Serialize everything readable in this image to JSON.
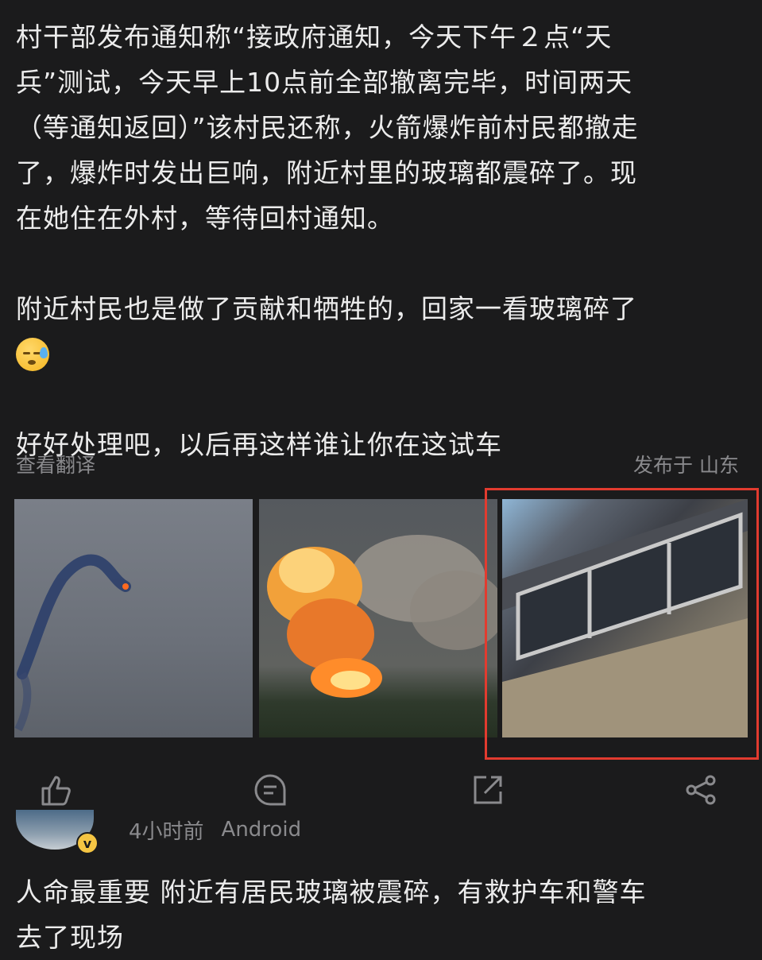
{
  "post": {
    "lines": [
      "村干部发布通知称“接政府通知，今天下午２点“天",
      "兵”测试，今天早上10点前全部撤离完毕，时间两天",
      "（等通知返回）”该村民还称，火箭爆炸前村民都撤走",
      "了，爆炸时发出巨响，附近村里的玻璃都震碎了。现",
      "在她住在外村，等待回村通知。"
    ],
    "paragraph2": "附近村民也是做了贡献和牺牲的，回家一看玻璃碎了",
    "emoji": "sweat-face-emoji",
    "paragraph3": "好好处理吧，以后再这样谁让你在这试车"
  },
  "meta": {
    "translate": "查看翻译",
    "location": "发布于 山东"
  },
  "images": [
    {
      "name": "rocket-trail-photo"
    },
    {
      "name": "explosion-photo"
    },
    {
      "name": "broken-window-photo"
    }
  ],
  "actions": {
    "like_icon": "thumbs-up-icon",
    "comment_icon": "comment-icon",
    "share_out_icon": "share-out-icon",
    "share_icon": "share-icon"
  },
  "reply": {
    "time": "4小时前",
    "device": "Android",
    "badge": "v",
    "lines": [
      "人命最重要  附近有居民玻璃被震碎，有救护车和警车",
      "去了现场"
    ]
  },
  "colors": {
    "background": "#1b1b1c",
    "text": "#ececec",
    "muted": "#8a8a8d",
    "highlight": "#e23b2f"
  }
}
